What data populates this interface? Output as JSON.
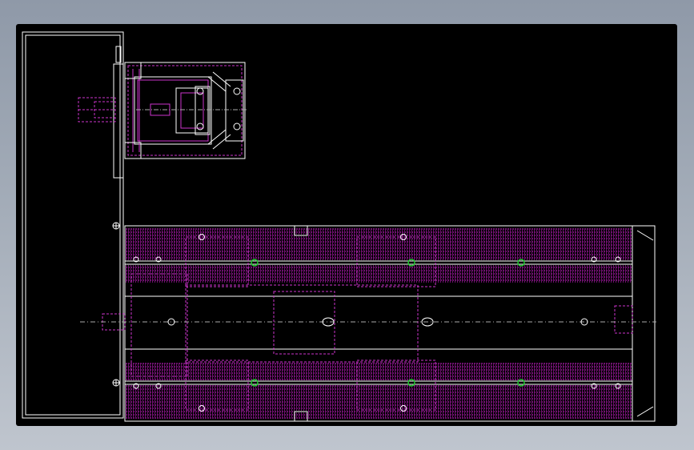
{
  "drawing": {
    "background": "#000000",
    "colors": {
      "line": "#ffffff",
      "hidden": "#cc33cc",
      "hatch": "#dd22dd",
      "hole": "#22cc33",
      "centerline": "#aaaaaa"
    },
    "components": [
      "end-plate",
      "motor-mount",
      "linear-module",
      "guide-rail-top",
      "guide-rail-bottom",
      "carriage",
      "lead-screw"
    ]
  }
}
